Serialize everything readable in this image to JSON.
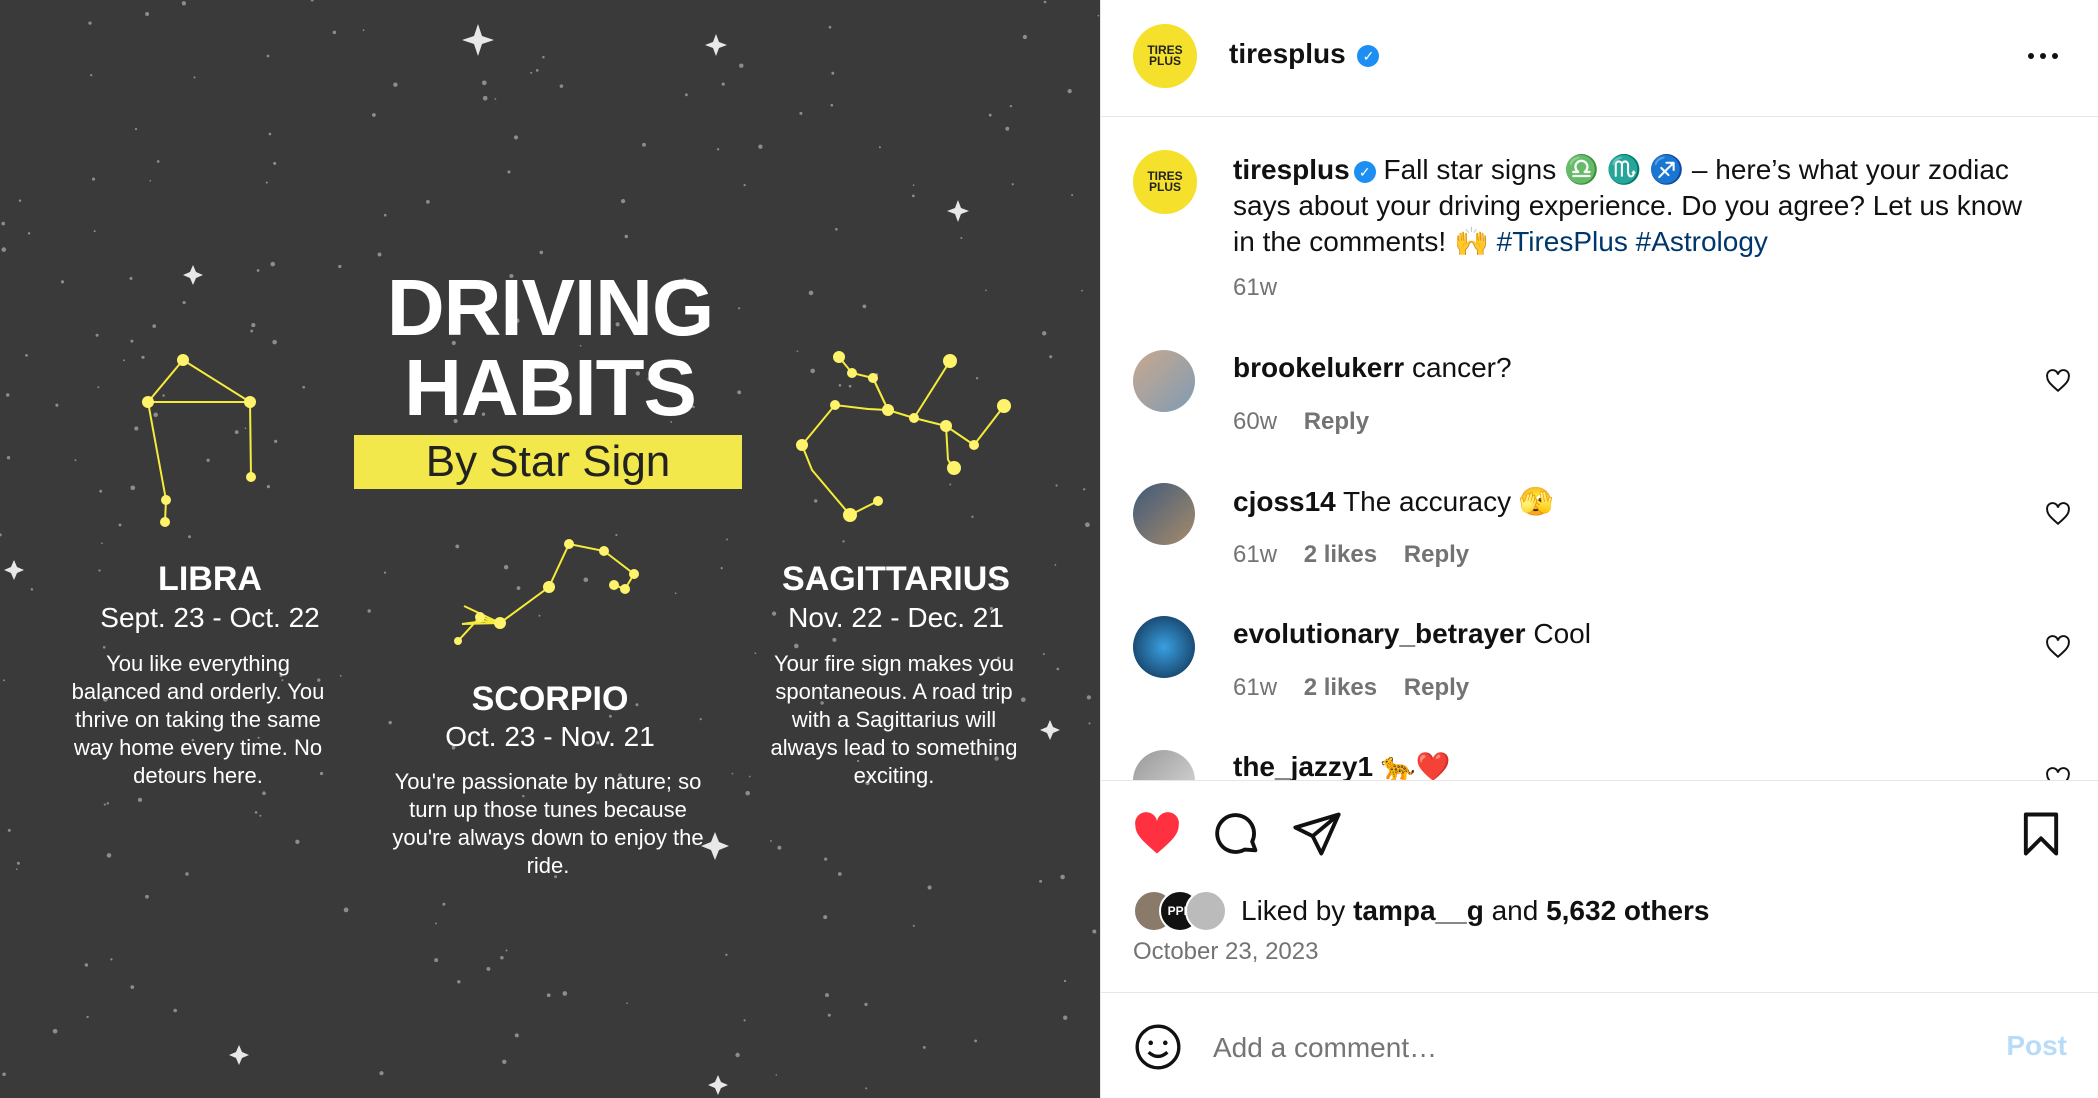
{
  "post_image": {
    "title_line1": "DRIVING",
    "title_line2": "HABITS",
    "subtitle": "By Star Sign",
    "signs": [
      {
        "name": "LIBRA",
        "dates": "Sept. 23 - Oct. 22",
        "desc": "You like everything balanced and orderly. You thrive on taking the same way home every time. No detours here."
      },
      {
        "name": "SCORPIO",
        "dates": "Oct. 23 - Nov. 21",
        "desc": "You're passionate by nature; so turn up those tunes because you're always down to enjoy the ride."
      },
      {
        "name": "SAGITTARIUS",
        "dates": "Nov. 22 - Dec. 21",
        "desc": "Your fire sign makes you spontaneous. A road trip with a Sagittarius will always lead to something exciting."
      }
    ],
    "colors": {
      "background": "#3a3a3a",
      "accent": "#f2e84b",
      "constellation": "#f5ec3a"
    }
  },
  "header": {
    "username": "tiresplus",
    "avatar_text": "TIRES PLUS",
    "more_icon": "more-horizontal-icon"
  },
  "caption": {
    "username": "tiresplus",
    "text": "Fall star signs ♎ ♏ ♐ – here’s what your zodiac says about your driving experience. Do you agree? Let us know in the comments! 🙌",
    "hashtags": "#TiresPlus #Astrology",
    "time": "61w"
  },
  "comments": [
    {
      "username": "brookelukerr",
      "text": "cancer?",
      "time": "60w",
      "likes": "",
      "reply": "Reply"
    },
    {
      "username": "cjoss14",
      "text": "The accuracy 🫣",
      "time": "61w",
      "likes": "2 likes",
      "reply": "Reply"
    },
    {
      "username": "evolutionary_betrayer",
      "text": "Cool",
      "time": "61w",
      "likes": "2 likes",
      "reply": "Reply"
    },
    {
      "username": "the_jazzy1",
      "text": "🐆❤️",
      "time": "",
      "likes": "",
      "reply": ""
    }
  ],
  "actions": {
    "like_icon": "heart-filled-icon",
    "comment_icon": "comment-icon",
    "share_icon": "paper-plane-icon",
    "save_icon": "bookmark-icon",
    "like_color": "#ff3040"
  },
  "likes": {
    "prefix": "Liked by",
    "user": "tampa__g",
    "and": "and",
    "others": "5,632 others",
    "liker_avatar_text": "PPK"
  },
  "date": "October 23, 2023",
  "add_comment": {
    "emoji_icon": "smiley-icon",
    "placeholder": "Add a comment…",
    "post_label": "Post",
    "post_color": "#b8dcf8"
  }
}
